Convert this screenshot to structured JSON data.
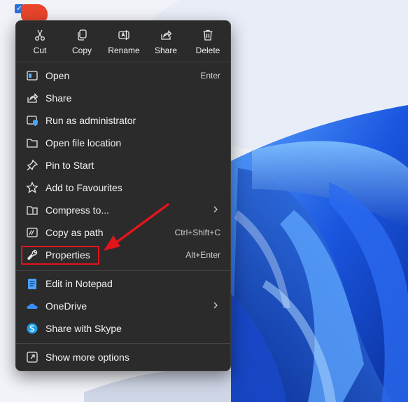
{
  "toolbar": {
    "cut": "Cut",
    "copy": "Copy",
    "rename": "Rename",
    "share": "Share",
    "delete": "Delete"
  },
  "menu": {
    "items": [
      {
        "label": "Open",
        "shortcut": "Enter",
        "icon": "open-icon"
      },
      {
        "label": "Share",
        "icon": "share-icon"
      },
      {
        "label": "Run as administrator",
        "icon": "shield-icon"
      },
      {
        "label": "Open file location",
        "icon": "folder-icon"
      },
      {
        "label": "Pin to Start",
        "icon": "pin-icon"
      },
      {
        "label": "Add to Favourites",
        "icon": "star-icon"
      },
      {
        "label": "Compress to...",
        "icon": "zip-folder-icon",
        "submenu": true
      },
      {
        "label": "Copy as path",
        "shortcut": "Ctrl+Shift+C",
        "icon": "copy-path-icon"
      },
      {
        "label": "Properties",
        "shortcut": "Alt+Enter",
        "icon": "wrench-icon"
      },
      {
        "label": "Edit in Notepad",
        "icon": "notepad-icon"
      },
      {
        "label": "OneDrive",
        "icon": "cloud-icon",
        "submenu": true
      },
      {
        "label": "Share with Skype",
        "icon": "skype-icon"
      },
      {
        "label": "Show more options",
        "icon": "more-options-icon"
      }
    ]
  },
  "colors": {
    "menu_bg": "#2b2b2b",
    "menu_text": "#f2f2f2",
    "highlight": "#e3141b",
    "wallpaper_blue": "#1f5fe0"
  }
}
